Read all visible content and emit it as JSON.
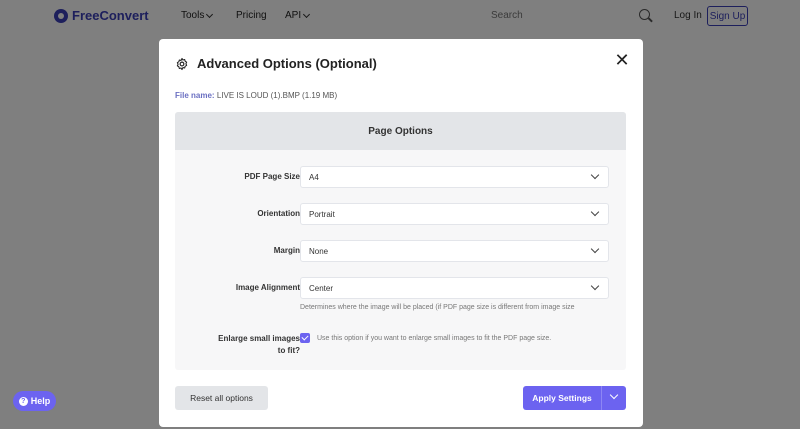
{
  "header": {
    "logo_text": "FreeConvert",
    "nav": [
      {
        "label": "Tools"
      },
      {
        "label": "Pricing"
      },
      {
        "label": "API"
      }
    ],
    "search_placeholder": "Search",
    "login_label": "Log In",
    "signup_label": "Sign Up"
  },
  "help": {
    "label": "Help"
  },
  "modal": {
    "title": "Advanced Options (Optional)",
    "close_glyph": "✕",
    "file_label": "File name:",
    "file_value": "LIVE IS LOUD (1).BMP (1.19 MB)",
    "section_title": "Page Options",
    "fields": [
      {
        "label": "PDF Page Size",
        "value": "A4"
      },
      {
        "label": "Orientation",
        "value": "Portrait"
      },
      {
        "label": "Margin",
        "value": "None"
      },
      {
        "label": "Image Alignment",
        "value": "Center"
      }
    ],
    "alignment_hint": "Determines where the image will be placed (if PDF page size is different from image size",
    "enlarge": {
      "label_line1": "Enlarge small images",
      "label_line2": "to fit?",
      "checked": true,
      "description": "Use this option if you want to enlarge small images to fit the PDF page size."
    },
    "reset_label": "Reset all options",
    "apply_label": "Apply Settings"
  },
  "colors": {
    "accent": "#6c63f0",
    "brand": "#3b3fb8",
    "section_header_bg": "#e3e5e8"
  }
}
